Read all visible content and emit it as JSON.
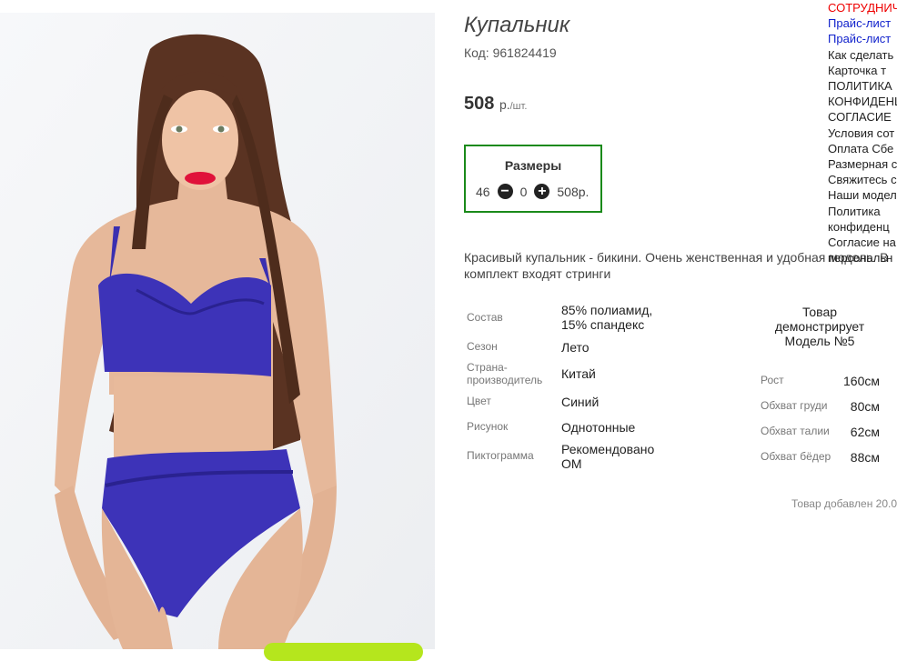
{
  "product": {
    "title": "Купальник",
    "code": "Код: 961824419",
    "price": "508",
    "price_unit": "р.",
    "price_per": "/шт.",
    "sizes_title": "Размеры",
    "size": "46",
    "minus_icon": "minus-circle-icon",
    "qty": "0",
    "plus_icon": "plus-circle-icon",
    "size_price": "508р.",
    "description": "Красивый купальник - бикини. Очень женственная и удобная модель. В комплект входят стринги",
    "properties": [
      {
        "label": "Состав",
        "value": "85% полиамид, 15% спандекс"
      },
      {
        "label": "Сезон",
        "value": "Лето"
      },
      {
        "label": "Страна-производитель",
        "value": "Китай"
      },
      {
        "label": "Цвет",
        "value": "Синий"
      },
      {
        "label": "Рисунок",
        "value": "Однотонные"
      },
      {
        "label": "Пиктограмма",
        "value": "Рекомендовано ОМ"
      }
    ],
    "model_heading": "Товар демонстрирует Модель №5",
    "measurements": [
      {
        "label": "Рост",
        "value": "160см"
      },
      {
        "label": "Обхват груди",
        "value": "80см"
      },
      {
        "label": "Обхват талии",
        "value": "62см"
      },
      {
        "label": "Обхват бёдер",
        "value": "88см"
      }
    ],
    "added": "Товар добавлен 20.0"
  },
  "sidebar": [
    {
      "label": "СОТРУДНИЧ",
      "color": "#e00000"
    },
    {
      "label": "Прайс-лист",
      "color": "#1122cc"
    },
    {
      "label": "Прайс-лист",
      "color": "#1122cc"
    },
    {
      "label": "Как сделать"
    },
    {
      "label": "Карточка т"
    },
    {
      "label": "ПОЛИТИКА"
    },
    {
      "label": "КОНФИДЕНЦ"
    },
    {
      "label": "СОГЛАСИЕ"
    },
    {
      "label": "Условия сот"
    },
    {
      "label": "Оплата Сбе"
    },
    {
      "label": "Размерная с"
    },
    {
      "label": "Свяжитесь с"
    },
    {
      "label": "Наши модел"
    },
    {
      "label": "Политика"
    },
    {
      "label": "конфиденц"
    },
    {
      "label": "Согласие на"
    },
    {
      "label": "персональн"
    }
  ]
}
